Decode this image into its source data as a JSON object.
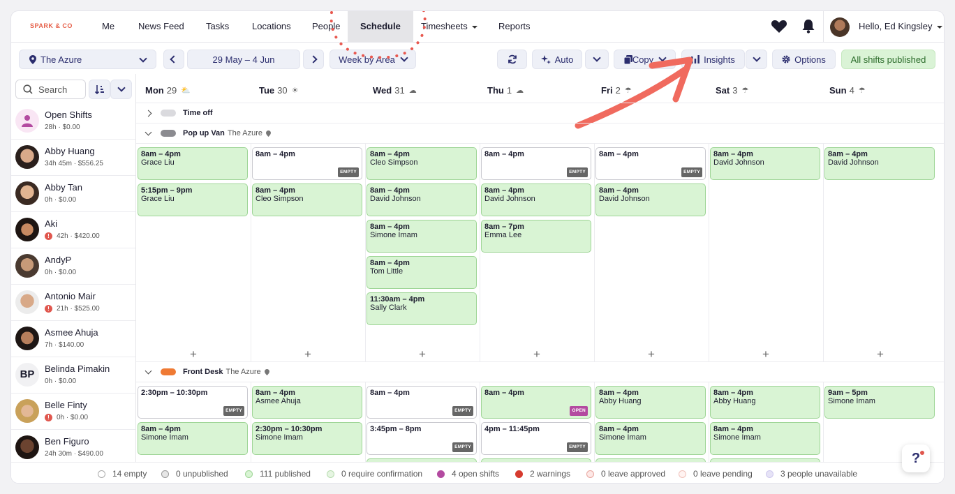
{
  "brand": "SPARK & CO",
  "nav": {
    "items": [
      "Me",
      "News Feed",
      "Tasks",
      "Locations",
      "People",
      "Schedule",
      "Timesheets",
      "Reports"
    ],
    "active": "Schedule",
    "greeting": "Hello, Ed Kingsley"
  },
  "toolbar": {
    "location": "The Azure",
    "date_range": "29 May – 4 Jun",
    "view": "Week by Area",
    "auto": "Auto",
    "copy": "Copy",
    "insights": "Insights",
    "options": "Options",
    "status": "All shifts published"
  },
  "search": {
    "label": "Search"
  },
  "days": [
    {
      "day": "Mon",
      "num": "29",
      "weather": "partly-cloudy-icon"
    },
    {
      "day": "Tue",
      "num": "30",
      "weather": "sun-icon"
    },
    {
      "day": "Wed",
      "num": "31",
      "weather": "cloud-icon"
    },
    {
      "day": "Thu",
      "num": "1",
      "weather": "cloud-icon"
    },
    {
      "day": "Fri",
      "num": "2",
      "weather": "rain-icon"
    },
    {
      "day": "Sat",
      "num": "3",
      "weather": "rain-icon"
    },
    {
      "day": "Sun",
      "num": "4",
      "weather": "rain-icon"
    }
  ],
  "employees": [
    {
      "name": "Open Shifts",
      "sub": "28h · $0.00",
      "warn": false,
      "avatar": "open-shifts"
    },
    {
      "name": "Abby Huang",
      "sub": "34h 45m · $556.25",
      "warn": false,
      "avatar": "photo"
    },
    {
      "name": "Abby Tan",
      "sub": "0h · $0.00",
      "warn": false,
      "avatar": "photo"
    },
    {
      "name": "Aki",
      "sub": "42h · $420.00",
      "warn": true,
      "avatar": "photo"
    },
    {
      "name": "AndyP",
      "sub": "0h · $0.00",
      "warn": false,
      "avatar": "photo"
    },
    {
      "name": "Antonio Mair",
      "sub": "21h · $525.00",
      "warn": true,
      "avatar": "photo"
    },
    {
      "name": "Asmee Ahuja",
      "sub": "7h · $140.00",
      "warn": false,
      "avatar": "photo"
    },
    {
      "name": "Belinda Pimakin",
      "sub": "0h · $0.00",
      "warn": false,
      "avatar": "initials",
      "initials": "BP"
    },
    {
      "name": "Belle Finty",
      "sub": "0h · $0.00",
      "warn": true,
      "avatar": "photo"
    },
    {
      "name": "Ben Figuro",
      "sub": "24h 30m · $490.00",
      "warn": false,
      "avatar": "photo"
    }
  ],
  "groups": {
    "time_off": {
      "name": "Time off"
    },
    "popup": {
      "name": "Pop up Van",
      "location": "The Azure"
    },
    "front": {
      "name": "Front Desk",
      "location": "The Azure"
    }
  },
  "popup_shifts": [
    [
      {
        "time": "8am – 4pm",
        "person": "Grace Liu",
        "green": true
      },
      {
        "time": "5:15pm – 9pm",
        "person": "Grace Liu",
        "green": true
      }
    ],
    [
      {
        "time": "8am – 4pm",
        "person": "",
        "green": false,
        "tag": "EMPTY"
      },
      {
        "time": "8am – 4pm",
        "person": "Cleo Simpson",
        "green": true
      }
    ],
    [
      {
        "time": "8am – 4pm",
        "person": "Cleo Simpson",
        "green": true
      },
      {
        "time": "8am – 4pm",
        "person": "David Johnson",
        "green": true
      },
      {
        "time": "8am – 4pm",
        "person": "Simone Imam",
        "green": true
      },
      {
        "time": "8am – 4pm",
        "person": "Tom Little",
        "green": true
      },
      {
        "time": "11:30am – 4pm",
        "person": "Sally Clark",
        "green": true
      }
    ],
    [
      {
        "time": "8am – 4pm",
        "person": "",
        "green": false,
        "tag": "EMPTY"
      },
      {
        "time": "8am – 4pm",
        "person": "David Johnson",
        "green": true
      },
      {
        "time": "8am – 7pm",
        "person": "Emma Lee",
        "green": true
      }
    ],
    [
      {
        "time": "8am – 4pm",
        "person": "",
        "green": false,
        "tag": "EMPTY"
      },
      {
        "time": "8am – 4pm",
        "person": "David Johnson",
        "green": true
      }
    ],
    [
      {
        "time": "8am – 4pm",
        "person": "David Johnson",
        "green": true
      }
    ],
    [
      {
        "time": "8am – 4pm",
        "person": "David Johnson",
        "green": true
      }
    ]
  ],
  "front_shifts": [
    [
      {
        "time": "2:30pm – 10:30pm",
        "person": "",
        "green": false,
        "tag": "EMPTY"
      },
      {
        "time": "8am – 4pm",
        "person": "Simone Imam",
        "green": true
      }
    ],
    [
      {
        "time": "8am – 4pm",
        "person": "Asmee Ahuja",
        "green": true
      },
      {
        "time": "2:30pm – 10:30pm",
        "person": "Simone Imam",
        "green": true
      }
    ],
    [
      {
        "time": "8am – 4pm",
        "person": "",
        "green": false,
        "tag": "EMPTY"
      },
      {
        "time": "3:45pm – 8pm",
        "person": "",
        "green": false,
        "tag": "EMPTY"
      }
    ],
    [
      {
        "time": "8am – 4pm",
        "person": "",
        "green": true,
        "tag": "OPEN"
      },
      {
        "time": "4pm – 11:45pm",
        "person": "",
        "green": false,
        "tag": "EMPTY"
      }
    ],
    [
      {
        "time": "8am – 4pm",
        "person": "Abby Huang",
        "green": true
      },
      {
        "time": "8am – 4pm",
        "person": "Simone Imam",
        "green": true
      }
    ],
    [
      {
        "time": "8am – 4pm",
        "person": "Abby Huang",
        "green": true
      },
      {
        "time": "8am – 4pm",
        "person": "Simone Imam",
        "green": true
      }
    ],
    [
      {
        "time": "9am – 5pm",
        "person": "Simone Imam",
        "green": true
      }
    ]
  ],
  "legend": [
    {
      "label": "14 empty",
      "color": "#ffffff",
      "border": "#aaaaaa"
    },
    {
      "label": "0 unpublished",
      "color": "#e6e6e6",
      "border": "#999999"
    },
    {
      "label": "111 published",
      "color": "#d9f4d4",
      "border": "#9ed596"
    },
    {
      "label": "0 require confirmation",
      "color": "#e6f5e2",
      "border": "#b8dcb0"
    },
    {
      "label": "4 open shifts",
      "color": "#b34aa0",
      "border": "#b34aa0"
    },
    {
      "label": "2 warnings",
      "color": "#d63b2f",
      "border": "#d63b2f"
    },
    {
      "label": "0 leave approved",
      "color": "#fde8e6",
      "border": "#e8a59e"
    },
    {
      "label": "0 leave pending",
      "color": "#fff3f1",
      "border": "#f0c2bb"
    },
    {
      "label": "3 people unavailable",
      "color": "#e6e3f6",
      "border": "#cfc9ee"
    }
  ],
  "help": {
    "label": "?"
  }
}
